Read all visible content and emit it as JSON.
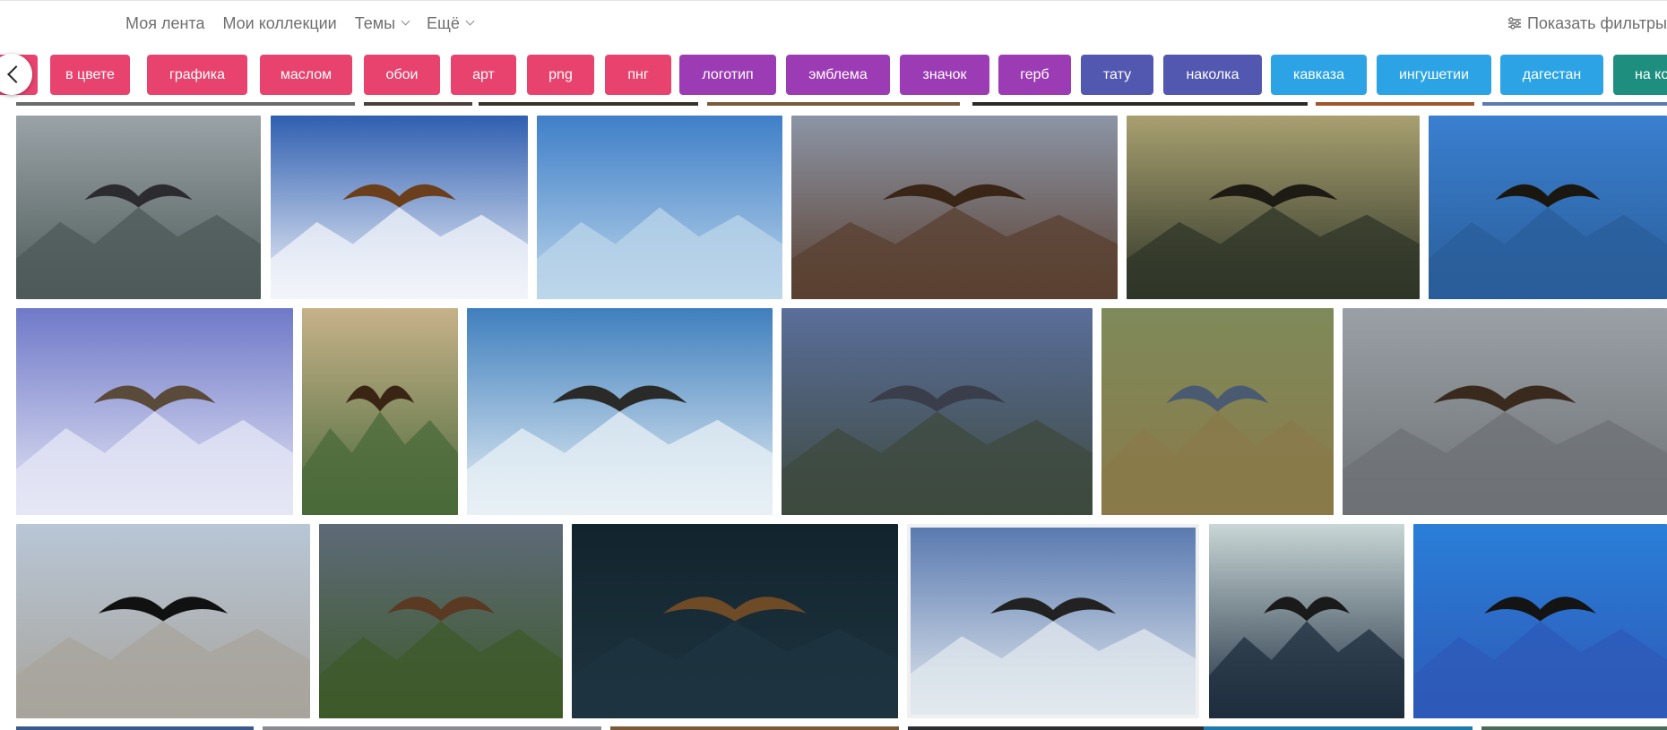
{
  "nav": {
    "feed": "Моя лента",
    "collections": "Мои коллекции",
    "themes": "Темы",
    "more": "Ещё",
    "show_filters": "Показать фильтры"
  },
  "tags": [
    {
      "label": "",
      "color": "#e8436e"
    },
    {
      "label": "в цвете",
      "color": "#e8436e"
    },
    {
      "label": "графика",
      "color": "#e8436e"
    },
    {
      "label": "маслом",
      "color": "#e8436e"
    },
    {
      "label": "обои",
      "color": "#e8436e"
    },
    {
      "label": "арт",
      "color": "#e8436e"
    },
    {
      "label": "png",
      "color": "#e8436e"
    },
    {
      "label": "пнг",
      "color": "#e8436e"
    },
    {
      "label": "логотип",
      "color": "#9c3cb4"
    },
    {
      "label": "эмблема",
      "color": "#9c3cb4"
    },
    {
      "label": "значок",
      "color": "#9c3cb4"
    },
    {
      "label": "герб",
      "color": "#9c3cb4"
    },
    {
      "label": "тату",
      "color": "#5257b0"
    },
    {
      "label": "наколка",
      "color": "#5257b0"
    },
    {
      "label": "кавказа",
      "color": "#2ba3e5"
    },
    {
      "label": "ингушетии",
      "color": "#2ba3e5"
    },
    {
      "label": "дагестан",
      "color": "#2ba3e5"
    },
    {
      "label": "на ко",
      "color": "#1e8f7e"
    }
  ],
  "icons": {
    "back": "chevron-left-icon",
    "filters": "sliders-icon",
    "dropdown": "chevron-down-icon"
  },
  "images": [
    {
      "name": "eagle-flying-mountains",
      "sky": "#9aa3a8",
      "ground": "#4e5a58",
      "bird": "#2b2b30"
    },
    {
      "name": "golden-eagle-painting",
      "sky": "#2f5fb0",
      "ground": "#f2f4fa",
      "bird": "#6b3e1c"
    },
    {
      "name": "mountain-lake-reflection",
      "sky": "#3f7fc8",
      "ground": "#bcd6ea",
      "bird": ""
    },
    {
      "name": "eagle-spread-wings",
      "sky": "#8c95a6",
      "ground": "#5a4030",
      "bird": "#3a2616"
    },
    {
      "name": "eagle-over-cliffs",
      "sky": "#a8a070",
      "ground": "#2f3528",
      "bird": "#1e1a14"
    },
    {
      "name": "eagle-blue-sky",
      "sky": "#3a7fd0",
      "ground": "#2a5e99",
      "bird": "#1a1610"
    },
    {
      "name": "hawk-snowy-mountain",
      "sky": "#6f79c8",
      "ground": "#e6e7f5",
      "bird": "#5a4a3a"
    },
    {
      "name": "bald-eagle-forest-sunset",
      "sky": "#c7b28a",
      "ground": "#4a6a3a",
      "bird": "#3a2414"
    },
    {
      "name": "eagle-winter-forest",
      "sky": "#3f7fbd",
      "ground": "#e8f0f5",
      "bird": "#2a2a28"
    },
    {
      "name": "eagle-statue-sunset",
      "sky": "#5a6e9a",
      "ground": "#3e4a3e",
      "bird": "#3a3e4a"
    },
    {
      "name": "sea-eagle-landing",
      "sky": "#7f8a5a",
      "ground": "#8a7a4a",
      "bird": "#4a5a70"
    },
    {
      "name": "eagle-gliding-blur",
      "sky": "#9aa0a6",
      "ground": "#6e7276",
      "bird": "#3a2a1e"
    },
    {
      "name": "black-bird-dolomites",
      "sky": "#b8c6d6",
      "ground": "#a8a49c",
      "bird": "#111111"
    },
    {
      "name": "eagle-chain-storm",
      "sky": "#5e6a78",
      "ground": "#3e5a2a",
      "bird": "#5a3a22"
    },
    {
      "name": "bald-eagle-dark-background",
      "sky": "#12242e",
      "ground": "#1e3440",
      "bird": "#6e4a26"
    },
    {
      "name": "snowy-peak-bird",
      "sky": "#5a7ab0",
      "ground": "#e2e8ee",
      "bird": "#222222"
    },
    {
      "name": "misty-forest-bird",
      "sky": "#c8d6d6",
      "ground": "#1e2e3e",
      "bird": "#1a1a1a"
    },
    {
      "name": "eagle-blue-lake",
      "sky": "#2a7fd8",
      "ground": "#2d59b8",
      "bird": "#141414"
    }
  ]
}
